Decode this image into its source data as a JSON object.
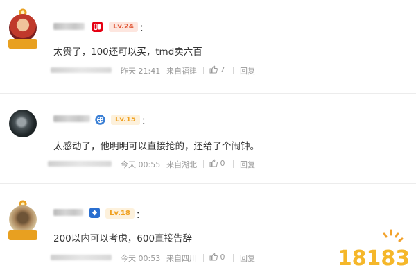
{
  "comments": [
    {
      "level": "Lv.24",
      "level_color": "#e05a3a",
      "badge": "switch-icon",
      "text": "太贵了，100还可以买，tmd卖六百",
      "time": "昨天 21:41",
      "location": "来自福建",
      "likes": "7",
      "reply": "回复"
    },
    {
      "level": "Lv.15",
      "level_color": "#f0a020",
      "badge": "globe-icon",
      "text": "太感动了，他明明可以直接抢的，还给了个闹钟。",
      "time": "今天 00:55",
      "location": "来自湖北",
      "likes": "0",
      "reply": "回复"
    },
    {
      "level": "Lv.18",
      "level_color": "#f0a020",
      "badge": "shield-icon",
      "text": "200以内可以考虑，600直接告辞",
      "time": "今天 00:53",
      "location": "来自四川",
      "likes": "0",
      "reply": "回复"
    }
  ],
  "colon": "：",
  "watermark": "18183"
}
